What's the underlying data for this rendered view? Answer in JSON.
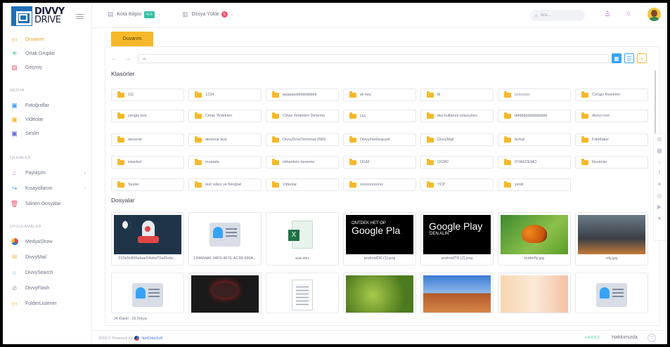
{
  "logo": {
    "line1": "DIVVY",
    "line2": "DRIVE"
  },
  "sidebar": {
    "items": [
      {
        "label": "Duvarım",
        "icon": "wall-icon"
      },
      {
        "label": "Ortak Gruplar",
        "icon": "share-nodes-icon"
      },
      {
        "label": "Geçmiş",
        "icon": "history-icon"
      }
    ],
    "media_title": "MEDYA",
    "media": [
      {
        "label": "Fotoğraflar",
        "icon": "photo-icon"
      },
      {
        "label": "Videolar",
        "icon": "video-icon"
      },
      {
        "label": "Sesler",
        "icon": "audio-icon"
      }
    ],
    "ops_title": "İŞLEMLER",
    "ops": [
      {
        "label": "Paylaşım",
        "icon": "share-icon"
      },
      {
        "label": "Kısayollarım",
        "icon": "shortcut-icon"
      },
      {
        "label": "Silinen Dosyalar",
        "icon": "trash-icon"
      }
    ],
    "apps_title": "UYGULAMALAR",
    "apps": [
      {
        "label": "MedyaShow",
        "icon": "mediashow-icon"
      },
      {
        "label": "DivvyMail",
        "icon": "mail-icon"
      },
      {
        "label": "DivvySearch",
        "icon": "search-icon"
      },
      {
        "label": "DivvyFlash",
        "icon": "flash-icon"
      },
      {
        "label": "FolderListener",
        "icon": "folder-listener-icon"
      }
    ]
  },
  "topbar": {
    "quota_label": "Kota Bilgisi",
    "quota_badge": "% 6",
    "upload_label": "Dosya Yükle",
    "upload_badge": "0",
    "search_placeholder": "Ara..."
  },
  "tab": {
    "label": "Duvarım"
  },
  "sections": {
    "folders": "Klasörler",
    "files": "Dosyalar"
  },
  "folders": [
    "111",
    "1234",
    "aaaaaasbbbbbbbbb",
    "ali bey",
    "bl",
    "cccccccc",
    "Cengiz Resimler",
    "cengiz test",
    "Cihaz Yedekleri",
    "Cihaz Yedekleri Deneme",
    "ççç",
    "dss kullanım kılavuzları",
    "ddddddddddddddd",
    "demo root",
    "deneme",
    "deneme test",
    "DivvyDriveTerminal-2583",
    "DivvyFileRequest",
    "DivvyMail",
    "ferhat",
    "FileMaker",
    "istanbul",
    "mustafa",
    "nilhanfoto deneme",
    "OGM",
    "OGM2",
    "OYAKDEMO",
    "Resimler",
    "Sesler",
    "test video ve fotoğraf",
    "Videolar",
    "xxxxxxxxxxxx",
    "YCP",
    "yenili"
  ],
  "files": [
    {
      "name": "010e9c806ebae54eba70a65cbc...",
      "kind": "rocket"
    },
    {
      "name": "134A04AF-94F6-467E-AC98-990A...",
      "kind": "contact"
    },
    {
      "name": "aaa.xlsx",
      "kind": "excel"
    },
    {
      "name": "androidDE (1).png",
      "kind": "gplay-de"
    },
    {
      "name": "androidTR (2).png",
      "kind": "gplay-tr"
    },
    {
      "name": "butterfly.jpg",
      "kind": "butterfly"
    },
    {
      "name": "city.jpg",
      "kind": "city"
    },
    {
      "name": "",
      "kind": "contact"
    },
    {
      "name": "",
      "kind": "car"
    },
    {
      "name": "",
      "kind": "document"
    },
    {
      "name": "",
      "kind": "leaves"
    },
    {
      "name": "",
      "kind": "desert"
    },
    {
      "name": "",
      "kind": "anime"
    },
    {
      "name": "",
      "kind": "contact"
    }
  ],
  "thumb_text": {
    "de_small": "ONTDEK HET OP",
    "de_big": "Google Pla",
    "tr_big": "Google Play",
    "tr_small": "'DEN ALIN"
  },
  "count_text": "34 Klasör - 29 Dosya",
  "footer": {
    "copyright": "2018 © Powered by",
    "company": "NetDataSoft",
    "version": "v.4.0.0.2",
    "about": "Hakkımızda",
    "help": "?"
  }
}
